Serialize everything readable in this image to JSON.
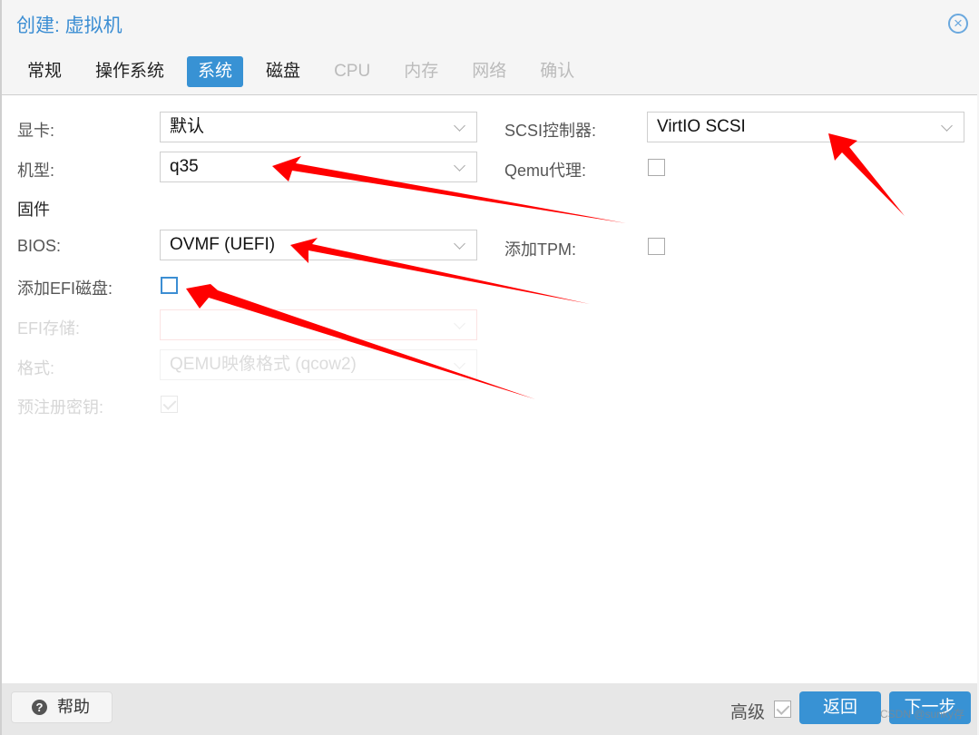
{
  "window": {
    "title": "创建: 虚拟机",
    "close_icon": "close-circle-icon"
  },
  "tabs": [
    {
      "label": "常规",
      "state": "normal"
    },
    {
      "label": "操作系统",
      "state": "normal"
    },
    {
      "label": "系统",
      "state": "active"
    },
    {
      "label": "磁盘",
      "state": "normal"
    },
    {
      "label": "CPU",
      "state": "disabled"
    },
    {
      "label": "内存",
      "state": "disabled"
    },
    {
      "label": "网络",
      "state": "disabled"
    },
    {
      "label": "确认",
      "state": "disabled"
    }
  ],
  "form": {
    "graphics": {
      "label": "显卡:",
      "value": "默认"
    },
    "machine": {
      "label": "机型:",
      "value": "q35"
    },
    "firmware_heading": "固件",
    "bios": {
      "label": "BIOS:",
      "value": "OVMF (UEFI)"
    },
    "add_efi": {
      "label": "添加EFI磁盘:",
      "checked": false
    },
    "efi_storage": {
      "label": "EFI存储:",
      "value": ""
    },
    "format": {
      "label": "格式:",
      "value": "QEMU映像格式 (qcow2)"
    },
    "pre_enroll": {
      "label": "预注册密钥:",
      "checked": true
    },
    "scsi": {
      "label": "SCSI控制器:",
      "value": "VirtIO SCSI"
    },
    "qemu_agent": {
      "label": "Qemu代理:",
      "checked": false
    },
    "add_tpm": {
      "label": "添加TPM:",
      "checked": false
    }
  },
  "footer": {
    "help_label": "帮助",
    "advanced_label": "高级",
    "advanced_checked": true,
    "back_label": "返回",
    "next_label": "下一步"
  },
  "watermark": "CSDN @sunky存",
  "annotation_color": "#ff0000"
}
